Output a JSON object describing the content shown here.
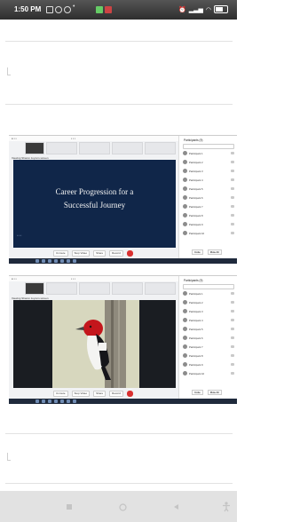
{
  "status_bar": {
    "time": "1:50 PM"
  },
  "meetings": [
    {
      "share_label": "Viewing Sharon Joyce's screen",
      "slide": {
        "line1": "Career Progression for a",
        "line2": "Successful Journey"
      },
      "panel_title": "Participants (9)",
      "participants": [
        "Participant 1",
        "Participant 2",
        "Participant 3",
        "Participant 4",
        "Participant 5",
        "Participant 6",
        "Participant 7",
        "Participant 8",
        "Participant 9",
        "Participant 10"
      ],
      "controls": [
        "Unmute",
        "Stop Video",
        "Share",
        "Record",
        "Leave"
      ],
      "footer": [
        "Invite",
        "Mute All"
      ]
    },
    {
      "share_label": "Viewing Sharon Joyce's screen",
      "panel_title": "Participants (9)",
      "participants": [
        "Participant 1",
        "Participant 2",
        "Participant 3",
        "Participant 4",
        "Participant 5",
        "Participant 6",
        "Participant 7",
        "Participant 8",
        "Participant 9",
        "Participant 10"
      ],
      "controls": [
        "Unmute",
        "Stop Video",
        "Share",
        "Record",
        "Leave"
      ],
      "footer": [
        "Invite",
        "Mute All"
      ]
    }
  ],
  "colors": {
    "slide_bg": "#102649",
    "leave_red": "#d93030",
    "status_bar": "#2e2e2e",
    "nav_bar": "#e2e2e2"
  },
  "icons": {
    "nav": [
      "recent-apps-icon",
      "home-icon",
      "back-icon",
      "accessibility-icon"
    ]
  }
}
